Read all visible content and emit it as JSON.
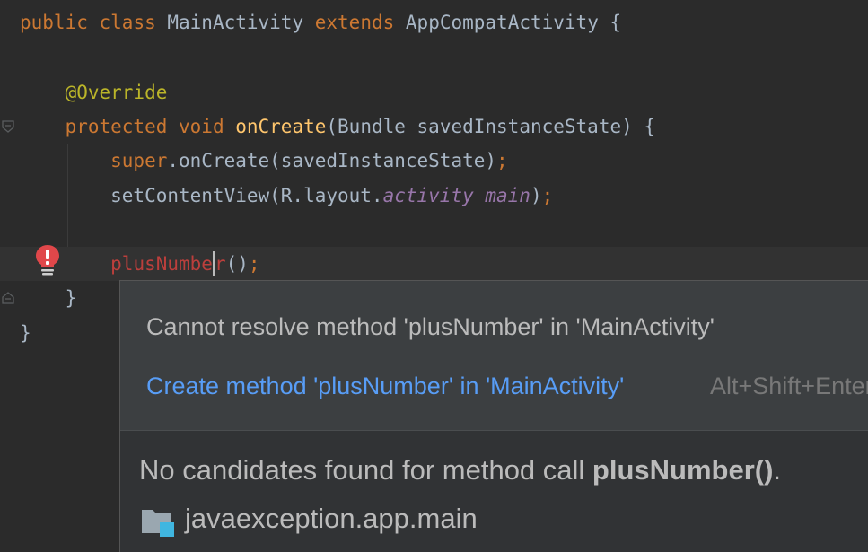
{
  "editor": {
    "lines": [
      {
        "id": "l1",
        "tokens": [
          {
            "t": "public ",
            "c": "kw"
          },
          {
            "t": "class ",
            "c": "kw"
          },
          {
            "t": "MainActivity ",
            "c": ""
          },
          {
            "t": "extends ",
            "c": "kw"
          },
          {
            "t": "AppCompatActivity {",
            "c": ""
          }
        ]
      },
      {
        "id": "l3",
        "tokens": [
          {
            "t": "    @Override",
            "c": "ann"
          }
        ]
      },
      {
        "id": "l4",
        "tokens": [
          {
            "t": "    protected ",
            "c": "kw"
          },
          {
            "t": "void ",
            "c": "kw"
          },
          {
            "t": "onCreate",
            "c": "fn"
          },
          {
            "t": "(Bundle savedInstanceState) {",
            "c": ""
          }
        ]
      },
      {
        "id": "l5",
        "tokens": [
          {
            "t": "        super",
            "c": "kw"
          },
          {
            "t": ".onCreate(savedInstanceState)",
            "c": ""
          },
          {
            "t": ";",
            "c": "punct-orange"
          }
        ]
      },
      {
        "id": "l6",
        "tokens": [
          {
            "t": "        setContentView(R.layout.",
            "c": ""
          },
          {
            "t": "activity_main",
            "c": "field"
          },
          {
            "t": ")",
            "c": ""
          },
          {
            "t": ";",
            "c": "punct-orange"
          }
        ]
      },
      {
        "id": "l9",
        "tokens": [
          {
            "t": "    }",
            "c": ""
          }
        ]
      },
      {
        "id": "l10",
        "tokens": [
          {
            "t": "}",
            "c": ""
          }
        ]
      }
    ],
    "error_line": {
      "indent": "        ",
      "before_caret": "plusNumbe",
      "after_caret": "r",
      "rest": "()",
      "semicolon": ";"
    }
  },
  "popup": {
    "message": "Cannot resolve method 'plusNumber' in 'MainActivity'",
    "action": "Create method 'plusNumber' in 'MainActivity'",
    "shortcut": "Alt+Shift+Enter",
    "candidates_prefix": "No candidates found for method call ",
    "candidates_method": "plusNumber()",
    "candidates_suffix": ".",
    "package": "javaexception.app.main",
    "package_icon": "package-folder-icon"
  },
  "colors": {
    "background": "#2b2b2b",
    "keyword": "#cc7832",
    "annotation": "#bbb529",
    "method": "#ffc66d",
    "field": "#9876aa",
    "error": "#bc3f3c",
    "link": "#589df6"
  }
}
